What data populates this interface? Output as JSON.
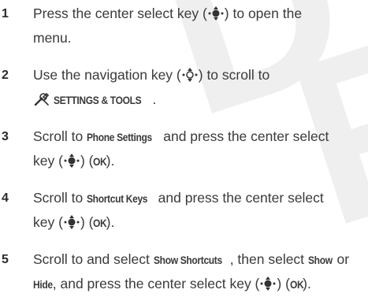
{
  "watermark": {
    "text": "DRAFT",
    "color": "#efefef"
  },
  "icons": {
    "center_select": "center-select-key-icon",
    "nav": "navigation-key-icon",
    "tools": "settings-tools-icon"
  },
  "steps": [
    {
      "number": "1",
      "t1": "Press the center select key (",
      "t2": ") to open the",
      "t3": "menu."
    },
    {
      "number": "2",
      "t1": "Use the navigation key (",
      "t2": ") to scroll to",
      "t3": "SETTINGS & TOOLS",
      "t4": "."
    },
    {
      "number": "3",
      "t1": "Scroll to ",
      "ui1": "Phone Settings",
      "t2": " and press the center select",
      "t3": "key (",
      "t4": ") (",
      "ui2": "OK",
      "t5": ")."
    },
    {
      "number": "4",
      "t1": "Scroll to ",
      "ui1": "Shortcut Keys",
      "t2": " and press the center select",
      "t3": "key (",
      "t4": ") (",
      "ui2": "OK",
      "t5": ")."
    },
    {
      "number": "5",
      "t1": "Scroll to and select ",
      "ui1": "Show Shortcuts",
      "t2": ", then select ",
      "ui2": "Show",
      "t3": " or",
      "ui3": "Hide",
      "t4": ", and press the center select key (",
      "t5": ") (",
      "ui4": "OK",
      "t6": ")."
    }
  ]
}
